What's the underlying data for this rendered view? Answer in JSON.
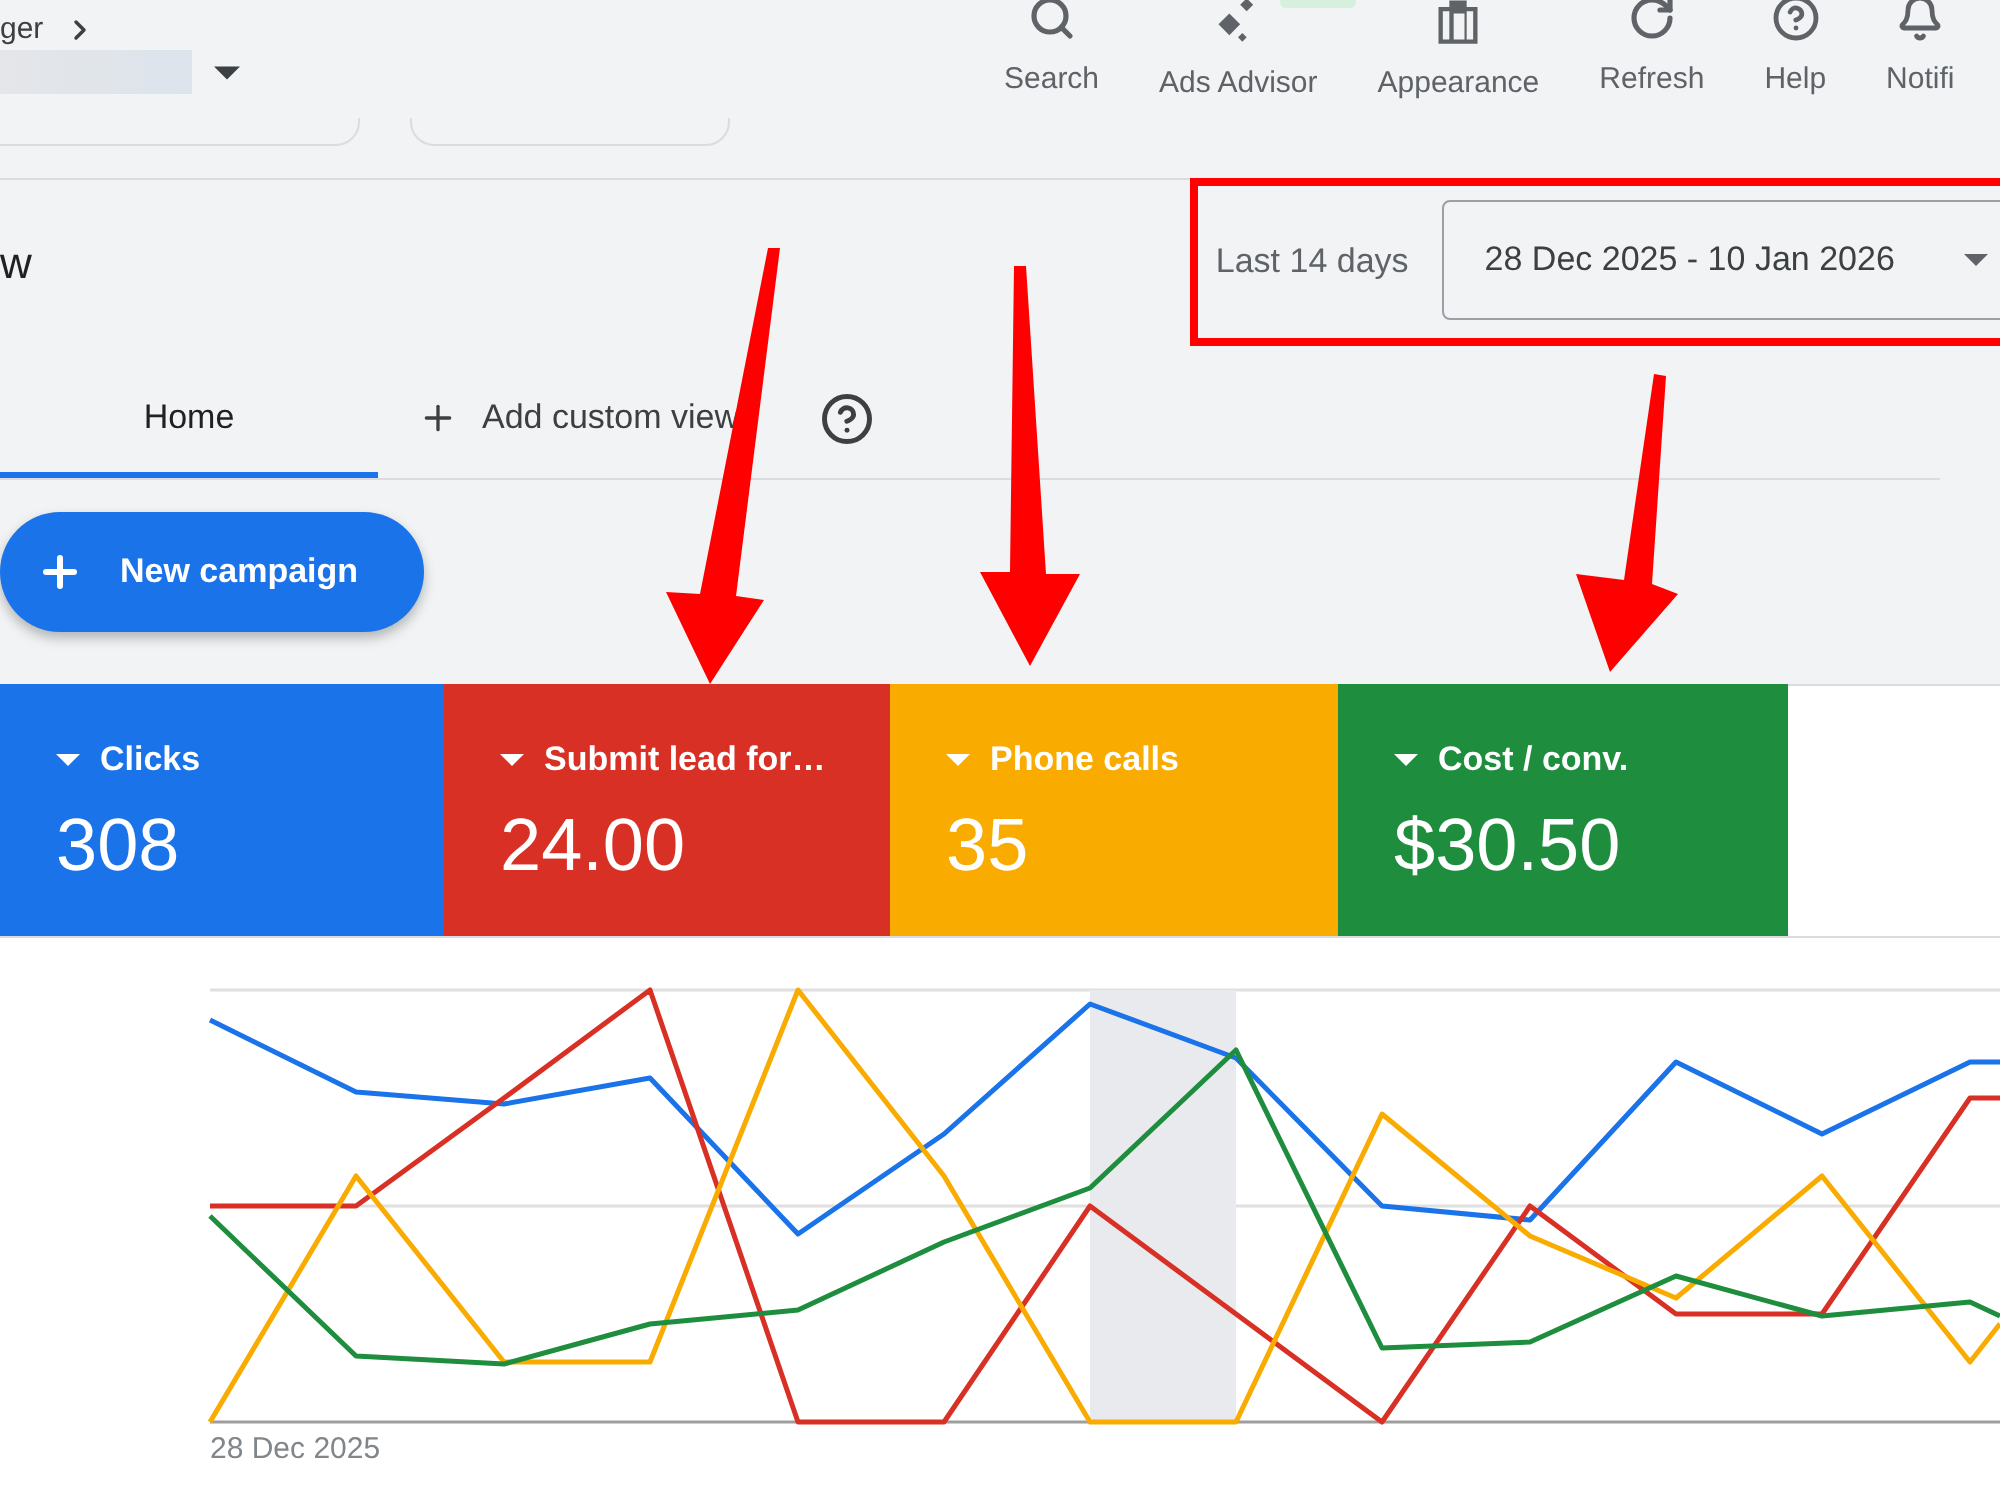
{
  "header": {
    "breadcrumb": "ger",
    "toolbar": [
      {
        "label": "Search"
      },
      {
        "label": "Ads Advisor"
      },
      {
        "label": "Appearance"
      },
      {
        "label": "Refresh"
      },
      {
        "label": "Help"
      },
      {
        "label": "Notifi"
      }
    ]
  },
  "page_title": "w",
  "date_range": {
    "period_label": "Last 14 days",
    "value": "28 Dec 2025 - 10 Jan 2026"
  },
  "tabs": [
    {
      "label": "Home",
      "selected": true,
      "kind": "view"
    },
    {
      "label": "Add custom view",
      "selected": false,
      "kind": "add"
    }
  ],
  "new_campaign_button": "New campaign",
  "metrics": [
    {
      "label": "Clicks",
      "value": "308",
      "color": "#1a73e8"
    },
    {
      "label": "Submit lead for…",
      "value": "24.00",
      "color": "#d93025"
    },
    {
      "label": "Phone calls",
      "value": "35",
      "color": "#f9ab00"
    },
    {
      "label": "Cost / conv.",
      "value": "$30.50",
      "color": "#1e8e3e"
    }
  ],
  "chart": {
    "x_start_label": "28 Dec 2025"
  }
}
